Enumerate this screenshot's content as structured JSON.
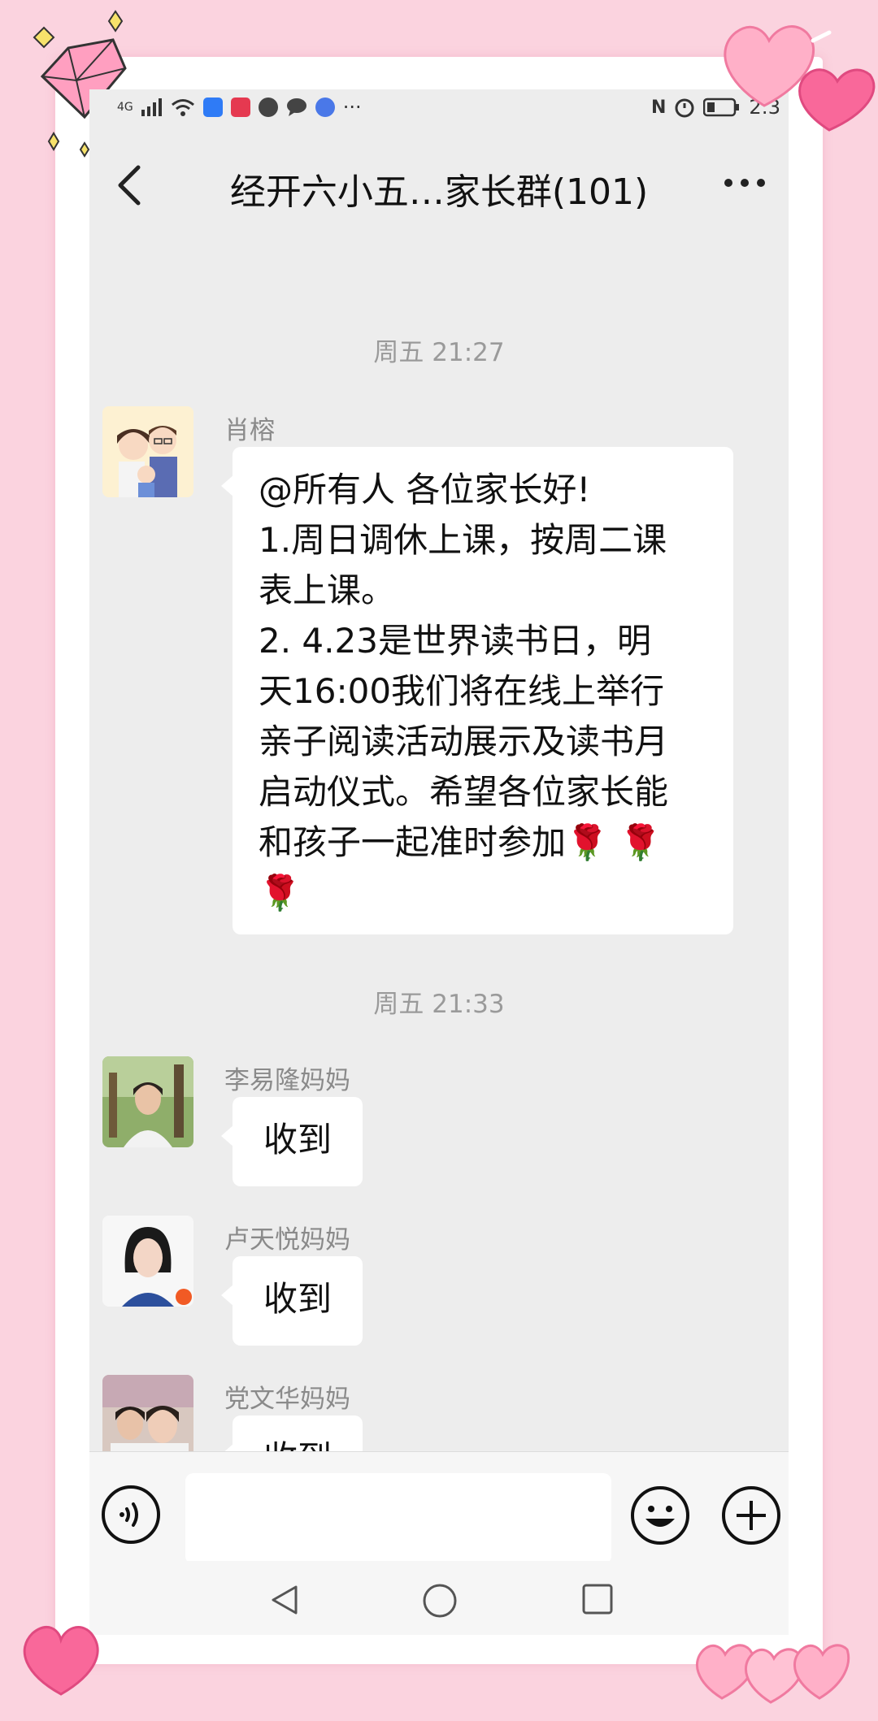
{
  "status_bar": {
    "network": "4G",
    "time": "2:3"
  },
  "header": {
    "title": "经开六小五…家长群(101)"
  },
  "chat": {
    "timestamps": [
      "周五 21:27",
      "周五 21:33"
    ],
    "messages": [
      {
        "sender": "肖榕",
        "avatar": "cartoon-family-avatar",
        "lines": [
          "@所有人 各位家长好!",
          "1.周日调休上课，按周二课",
          "表上课。",
          "2.  4.23是世界读书日，明",
          "天16:00我们将在线上举行",
          "亲子阅读活动展示及读书月",
          "启动仪式。希望各位家长能",
          "和孩子一起准时参加🌹 🌹",
          "🌹"
        ]
      },
      {
        "sender": "李易隆妈妈",
        "avatar": "photo-avatar",
        "text": "收到"
      },
      {
        "sender": "卢天悦妈妈",
        "avatar": "photo-avatar",
        "text": "收到"
      },
      {
        "sender": "党文华妈妈",
        "avatar": "photo-avatar",
        "text": "收到"
      }
    ]
  },
  "input_bar": {
    "placeholder": ""
  },
  "colors": {
    "background_pink": "#fbd3df",
    "chat_background": "#ededed",
    "bubble": "#ffffff"
  }
}
